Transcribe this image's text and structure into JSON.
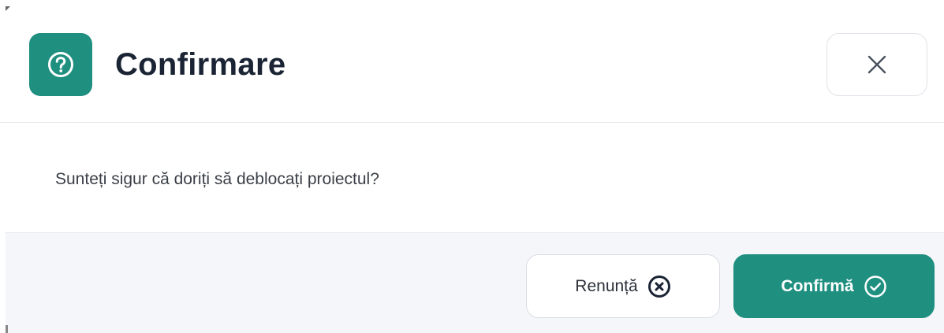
{
  "dialog": {
    "title": "Confirmare",
    "header_icon": "question-circle-icon",
    "close_icon": "close-icon",
    "message": "Sunteți sigur că doriți să deblocați proiectul?",
    "buttons": {
      "cancel_label": "Renunță",
      "cancel_icon": "x-circle-icon",
      "confirm_label": "Confirmă",
      "confirm_icon": "check-circle-icon"
    }
  },
  "colors": {
    "accent": "#1f8f80",
    "title": "#1b2434",
    "text": "#3a3f47",
    "footer_bg": "#f4f6fa",
    "border": "#dfe3e8"
  }
}
